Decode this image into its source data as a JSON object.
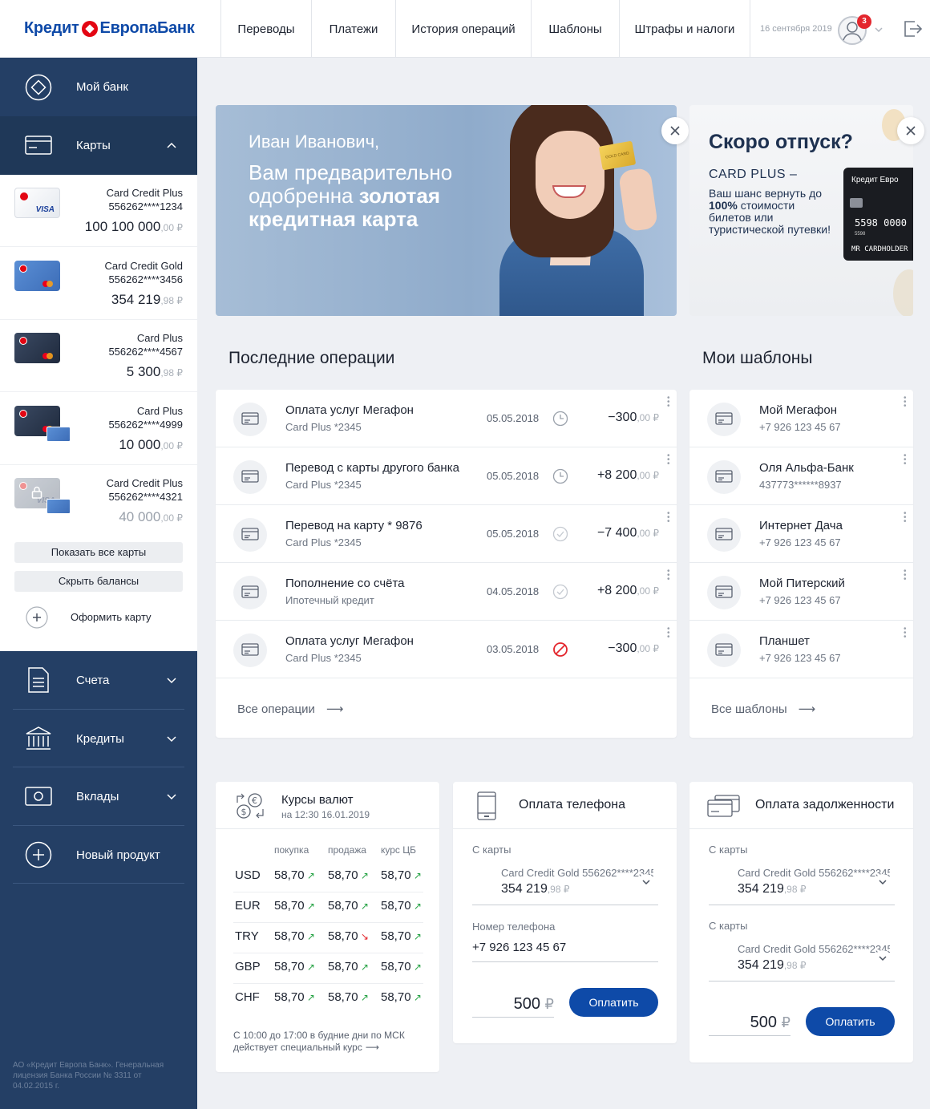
{
  "header": {
    "logo_left": "Кредит",
    "logo_right": "ЕвропаБанк",
    "nav": [
      "Переводы",
      "Платежи",
      "История операций",
      "Шаблоны",
      "Штрафы и налоги"
    ],
    "date": "16 сентября 2019",
    "notifications": "3"
  },
  "sidebar": {
    "my_bank": "Мой банк",
    "cards": "Карты",
    "card_list": [
      {
        "name": "Card Credit Plus",
        "number": "556262****1234",
        "balance_int": "100 100 000",
        "balance_dec": ",00 ₽",
        "brand": "VISA"
      },
      {
        "name": "Card Credit Gold",
        "number": "556262****3456",
        "balance_int": "354 219",
        "balance_dec": ",98 ₽"
      },
      {
        "name": "Card Plus",
        "number": "556262****4567",
        "balance_int": "5 300",
        "balance_dec": ",98 ₽"
      },
      {
        "name": "Card Plus",
        "number": "556262****4999",
        "balance_int": "10 000",
        "balance_dec": ",00 ₽"
      },
      {
        "name": "Card Credit Plus",
        "number": "556262****4321",
        "balance_int": "40 000",
        "balance_dec": ",00 ₽",
        "brand": "VISA"
      }
    ],
    "show_all": "Показать все карты",
    "hide_balances": "Скрыть балансы",
    "new_card": "Оформить карту",
    "accounts": "Счета",
    "credits": "Кредиты",
    "deposits": "Вклады",
    "new_product": "Новый продукт",
    "legal": "АО «Кредит Европа Банк». Генеральная лицензия Банка России № 3311 от 04.02.2015 г."
  },
  "banner1": {
    "greeting": "Иван Иванович,",
    "line1": "Вам предварительно",
    "line2a": "одобренна ",
    "line2b": "золотая",
    "line3": "кредитная карта",
    "gold_card_label": "GOLD CARD"
  },
  "banner2": {
    "title": "Скоро отпуск?",
    "subtitle": "CARD PLUS –",
    "text_a": "Ваш шанс вернуть до ",
    "text_b": "100%",
    "text_c": " стоимости билетов или туристической путевки!",
    "card_brand": "Кредит Евро",
    "card_number": "5598 0000",
    "card_small": "5598",
    "card_holder": "MR CARDHOLDER"
  },
  "operations": {
    "title": "Последние операции",
    "rows": [
      {
        "title": "Оплата услуг Мегафон",
        "sub": "Card Plus *2345",
        "date": "05.05.2018",
        "status": "pending",
        "amount_int": "−300",
        "amount_dec": ",00 ₽"
      },
      {
        "title": "Перевод с карты другого банка",
        "sub": "Card Plus *2345",
        "date": "05.05.2018",
        "status": "pending",
        "amount_int": "+8 200",
        "amount_dec": ",00 ₽"
      },
      {
        "title": "Перевод на карту * 9876",
        "sub": "Card Plus *2345",
        "date": "05.05.2018",
        "status": "done",
        "amount_int": "−7 400",
        "amount_dec": ",00 ₽"
      },
      {
        "title": "Пополнение со счёта",
        "sub": "Ипотечный кредит",
        "date": "04.05.2018",
        "status": "done",
        "amount_int": "+8 200",
        "amount_dec": ",00 ₽"
      },
      {
        "title": "Оплата услуг Мегафон",
        "sub": "Card Plus *2345",
        "date": "03.05.2018",
        "status": "declined",
        "amount_int": "−300",
        "amount_dec": ",00 ₽"
      }
    ],
    "all_link": "Все операции"
  },
  "templates": {
    "title": "Мои шаблоны",
    "rows": [
      {
        "title": "Мой Мегафон",
        "sub": "+7 926 123 45 67"
      },
      {
        "title": "Оля Альфа-Банк",
        "sub": "437773******8937"
      },
      {
        "title": "Интернет Дача",
        "sub": "+7 926 123 45 67"
      },
      {
        "title": "Мой Питерский",
        "sub": "+7 926 123 45 67"
      },
      {
        "title": "Планшет",
        "sub": "+7 926 123 45 67"
      }
    ],
    "all_link": "Все шаблоны"
  },
  "rates": {
    "title": "Курсы валют",
    "subtitle": "на 12:30 16.01.2019",
    "headers": [
      "покупка",
      "продажа",
      "курс ЦБ"
    ],
    "rows": [
      {
        "cur": "USD",
        "buy": "58,70",
        "sell": "58,70",
        "cb": "58,70",
        "trend": [
          "up",
          "up",
          "up"
        ]
      },
      {
        "cur": "EUR",
        "buy": "58,70",
        "sell": "58,70",
        "cb": "58,70",
        "trend": [
          "up",
          "up",
          "up"
        ]
      },
      {
        "cur": "TRY",
        "buy": "58,70",
        "sell": "58,70",
        "cb": "58,70",
        "trend": [
          "up",
          "down",
          "up"
        ]
      },
      {
        "cur": "GBP",
        "buy": "58,70",
        "sell": "58,70",
        "cb": "58,70",
        "trend": [
          "up",
          "up",
          "up"
        ]
      },
      {
        "cur": "CHF",
        "buy": "58,70",
        "sell": "58,70",
        "cb": "58,70",
        "trend": [
          "up",
          "up",
          "up"
        ]
      }
    ],
    "note_line1": "С 10:00 до 17:00 в будние дни по МСК",
    "note_line2": "действует специальный курс"
  },
  "phone": {
    "title": "Оплата телефона",
    "from_label": "С карты",
    "card_name": "Card Credit Gold 556262****2345",
    "card_int": "354 219",
    "card_dec": ",98 ₽",
    "phone_label": "Номер телефона",
    "phone_value": "+7 926 123 45 67",
    "amount": "500",
    "currency": "₽",
    "pay": "Оплатить"
  },
  "debt": {
    "title": "Оплата задолженности",
    "from_label": "С карты",
    "card_name": "Card Credit Gold 556262****2345",
    "card_int": "354 219",
    "card_dec": ",98 ₽",
    "from_label2": "С карты",
    "card_name2": "Card Credit Gold 556262****2345",
    "card_int2": "354 219",
    "card_dec2": ",98 ₽",
    "amount": "500",
    "currency": "₽",
    "pay": "Оплатить"
  },
  "colors": {
    "sidebar": "#243f65",
    "primary_button": "#0e4aa8",
    "brand_red": "#e30613",
    "positive": "#25a244",
    "negative": "#e3262d"
  }
}
